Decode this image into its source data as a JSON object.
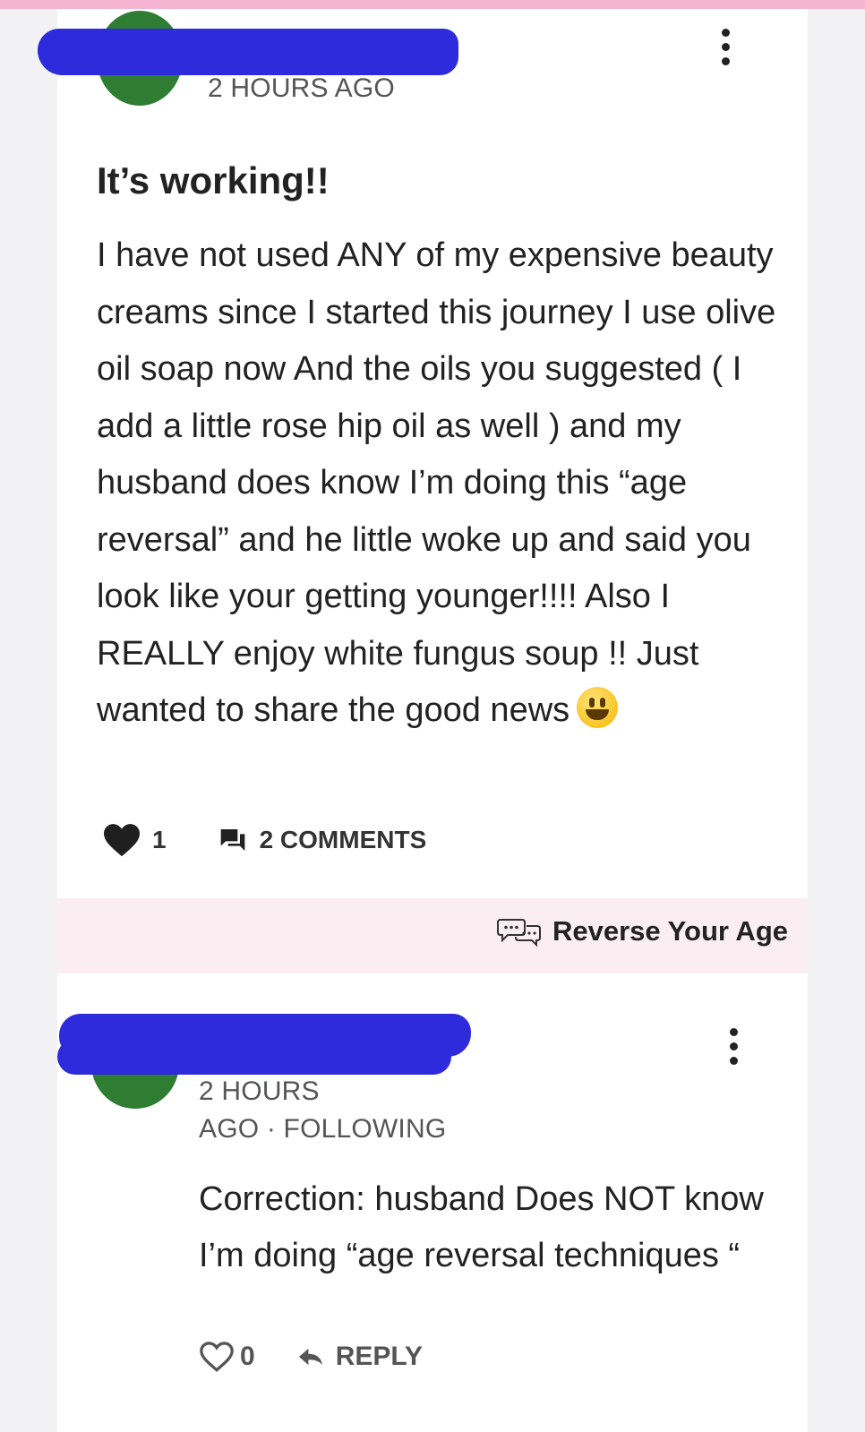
{
  "post": {
    "time": "2 HOURS AGO",
    "title": "It’s working!!",
    "body": "I have not used ANY of my expensive beauty creams since I started this journey I use olive oil soap now And the oils you suggested ( I add a little rose hip oil as well ) and my husband does know I’m doing this “age reversal” and he little woke up and said you look like your getting younger!!!! Also I REALLY enjoy white fungus soup !! Just wanted to share the good news",
    "likes": "1",
    "comments": "2 COMMENTS",
    "group": "Reverse Your Age"
  },
  "reply": {
    "time_line1": "2 HOURS",
    "time_line2": "AGO · FOLLOWING",
    "body": "Correction: husband  Does NOT know I’m doing “age reversal techniques “",
    "likes": "0",
    "reply_label": "REPLY"
  },
  "icons": {
    "like": "heart-icon",
    "comment": "comment-bubble-icon",
    "group": "chat-bubbles-icon",
    "reply": "reply-arrow-icon",
    "menu": "kebab-menu-icon"
  },
  "colors": {
    "redaction": "#2e2bdc",
    "avatar": "#2e7d32",
    "accent_strip": "#f6b4d3",
    "footer_band": "#fbeef2"
  }
}
